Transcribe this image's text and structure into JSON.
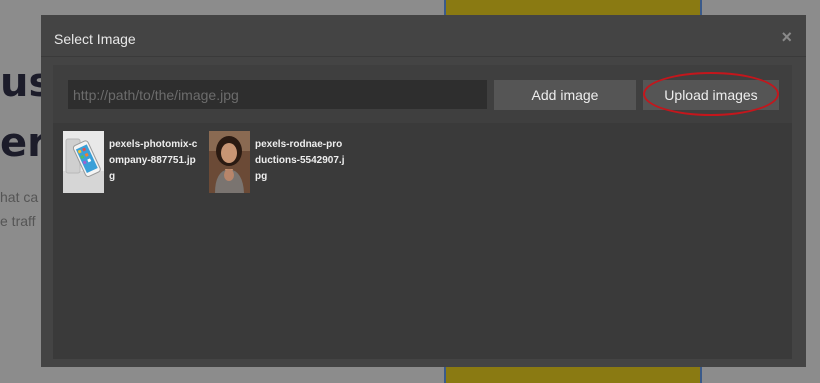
{
  "background": {
    "heading_line1": "ust",
    "heading_line2": "er",
    "text_line1": "hat ca",
    "text_line2": "e traff"
  },
  "modal": {
    "title": "Select Image",
    "close_glyph": "×",
    "url_placeholder": "http://path/to/the/image.jpg",
    "add_button": "Add image",
    "upload_button": "Upload images",
    "assets": [
      {
        "name": "pexels-photomix-company-887751.jpg",
        "thumb_icon": "phone-photo-thumbnail"
      },
      {
        "name": "pexels-rodnae-productions-5542907.jpg",
        "thumb_icon": "woman-portrait-thumbnail"
      }
    ]
  },
  "colors": {
    "overlay": "#6f6f6f",
    "modal_bg": "#444444",
    "body_bg": "#3a3a3a",
    "button_bg": "#555555",
    "annotation_ring": "#c4161c"
  }
}
